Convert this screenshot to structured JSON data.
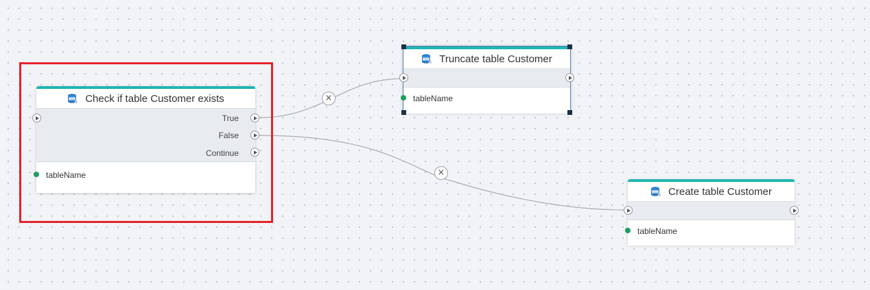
{
  "nodes": {
    "check": {
      "title": "Check if table Customer exists",
      "icon": "sql-database-icon",
      "outputs": [
        "True",
        "False",
        "Continue"
      ],
      "params": [
        "tableName"
      ]
    },
    "truncate": {
      "title": "Truncate table Customer",
      "icon": "sql-database-icon",
      "params": [
        "tableName"
      ]
    },
    "create": {
      "title": "Create table Customer",
      "icon": "sql-database-icon",
      "params": [
        "tableName"
      ]
    }
  },
  "wire_delete_symbol": "×",
  "colors": {
    "accent": "#1fb5b5",
    "param_dot": "#1e9e5c",
    "highlight": "#e3232c",
    "selection_handle": "#1b2f4a"
  }
}
